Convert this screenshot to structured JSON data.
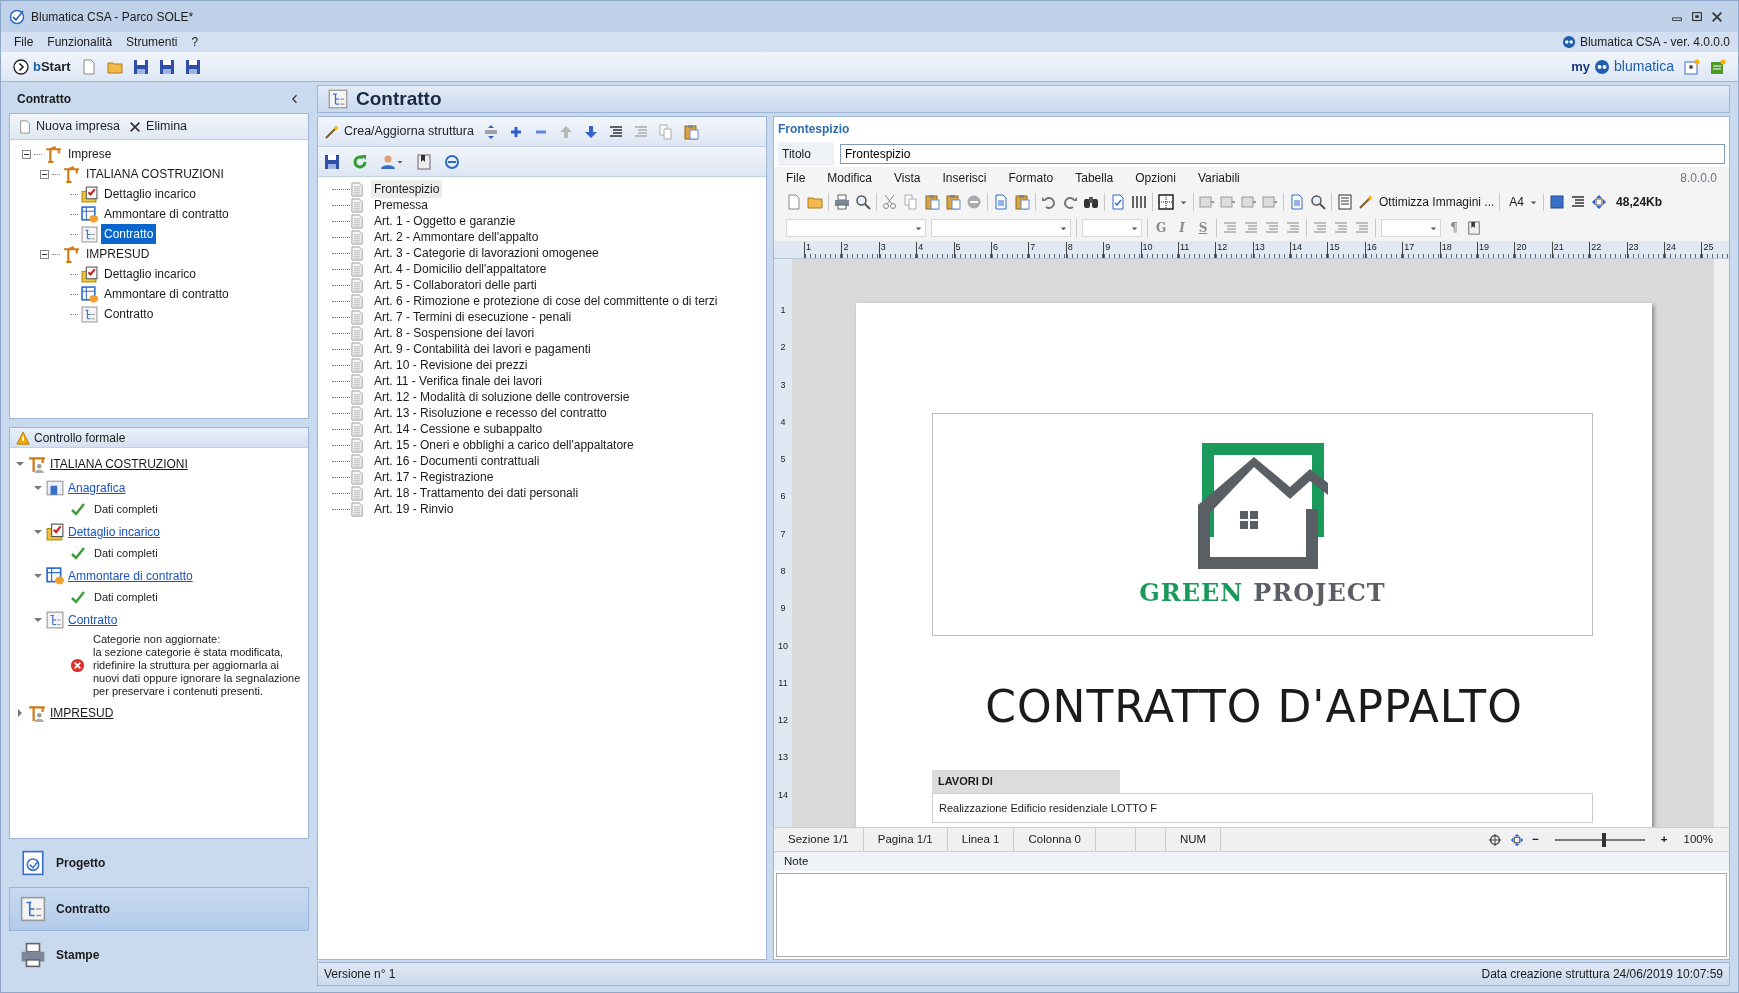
{
  "window": {
    "title": "Blumatica CSA - Parco SOLE*"
  },
  "menu": [
    "File",
    "Funzionalità",
    "Strumenti",
    "?"
  ],
  "version_label": "Blumatica CSA - ver. 4.0.0.0",
  "toolbar": {
    "start": "**b**Start"
  },
  "brand": {
    "prefix": "my",
    "name": "blumatica"
  },
  "left_panel": {
    "title": "Contratto",
    "actions": [
      "Nuova impresa",
      "Elimina"
    ],
    "tree": [
      {
        "label": "Imprese",
        "kind": "crane",
        "expanded": true,
        "selected": false,
        "children": [
          {
            "label": "ITALIANA COSTRUZIONI",
            "kind": "crane",
            "expanded": true,
            "selected": false,
            "children": [
              {
                "label": "Dettaglio incarico",
                "kind": "detail",
                "selected": false
              },
              {
                "label": "Ammontare di contratto",
                "kind": "amount",
                "selected": false
              },
              {
                "label": "Contratto",
                "kind": "contract",
                "selected": true
              }
            ]
          },
          {
            "label": "IMPRESUD",
            "kind": "crane",
            "expanded": true,
            "selected": false,
            "children": [
              {
                "label": "Dettaglio incarico",
                "kind": "detail",
                "selected": false
              },
              {
                "label": "Ammontare di contratto",
                "kind": "amount",
                "selected": false
              },
              {
                "label": "Contratto",
                "kind": "contract",
                "selected": false
              }
            ]
          }
        ]
      }
    ]
  },
  "check_panel": {
    "title": "Controllo formale",
    "tree": [
      {
        "label": "ITALIANA COSTRUZIONI",
        "kind": "company",
        "expanded": true,
        "children": [
          {
            "label": "Anagrafica",
            "kind": "registry",
            "expanded": true,
            "messages": [
              {
                "kind": "ok",
                "text": "Dati completi"
              }
            ]
          },
          {
            "label": "Dettaglio incarico",
            "kind": "detail",
            "expanded": true,
            "messages": [
              {
                "kind": "ok",
                "text": "Dati completi"
              }
            ]
          },
          {
            "label": "Ammontare di contratto",
            "kind": "amount",
            "expanded": true,
            "messages": [
              {
                "kind": "ok",
                "text": "Dati completi"
              }
            ]
          },
          {
            "label": "Contratto",
            "kind": "contract",
            "expanded": true,
            "messages": [
              {
                "kind": "error",
                "text": "Categorie non aggiornate:\nla sezione categorie è stata modificata,\nridefinire la struttura per aggiornarla ai\nnuovi dati oppure ignorare la segnalazione\nper preservare i contenuti presenti."
              }
            ]
          }
        ]
      },
      {
        "label": "IMPRESUD",
        "kind": "company",
        "expanded": false
      }
    ]
  },
  "nav": [
    {
      "label": "Progetto",
      "kind": "project",
      "selected": false
    },
    {
      "label": "Contratto",
      "kind": "contract",
      "selected": true
    },
    {
      "label": "Stampe",
      "kind": "print",
      "selected": false
    }
  ],
  "main": {
    "title": "Contratto",
    "build_button": "Crea/Aggiorna struttura",
    "sections": [
      {
        "label": "Frontespizio",
        "selected": true
      },
      {
        "label": "Premessa",
        "selected": false
      },
      {
        "label": "Art. 1 - Oggetto e garanzie",
        "selected": false
      },
      {
        "label": "Art. 2 - Ammontare dell'appalto",
        "selected": false
      },
      {
        "label": "Art. 3 - Categorie di lavorazioni omogenee",
        "selected": false
      },
      {
        "label": "Art. 4 - Domicilio dell'appaltatore",
        "selected": false
      },
      {
        "label": "Art. 5 - Collaboratori delle parti",
        "selected": false
      },
      {
        "label": "Art. 6 - Rimozione e protezione di cose del committente o di terzi",
        "selected": false
      },
      {
        "label": "Art. 7 - Termini di esecuzione - penali",
        "selected": false
      },
      {
        "label": "Art. 8 - Sospensione dei lavori",
        "selected": false
      },
      {
        "label": "Art. 9 - Contabilità dei lavori e pagamenti",
        "selected": false
      },
      {
        "label": "Art. 10 - Revisione dei prezzi",
        "selected": false
      },
      {
        "label": "Art. 11 - Verifica finale dei lavori",
        "selected": false
      },
      {
        "label": "Art. 12 - Modalità di soluzione delle controversie",
        "selected": false
      },
      {
        "label": "Art. 13 - Risoluzione e recesso del contratto",
        "selected": false
      },
      {
        "label": "Art. 14 - Cessione e subappalto",
        "selected": false
      },
      {
        "label": "Art. 15 - Oneri e obblighi a carico dell'appaltatore",
        "selected": false
      },
      {
        "label": "Art. 16 - Documenti contrattuali",
        "selected": false
      },
      {
        "label": "Art. 17 - Registrazione",
        "selected": false
      },
      {
        "label": "Art. 18 - Trattamento dei dati personali",
        "selected": false
      },
      {
        "label": "Art. 19 - Rinvio",
        "selected": false
      }
    ],
    "version": "Versione n° 1",
    "created": "Data creazione struttura 24/06/2019 10:07:59"
  },
  "editor": {
    "heading": "Frontespizio",
    "title_label": "Titolo",
    "title_value": "Frontespizio",
    "menu": [
      "File",
      "Modifica",
      "Vista",
      "Inserisci",
      "Formato",
      "Tabella",
      "Opzioni",
      "Variabili"
    ],
    "build": "8.0.0.0",
    "optimize": "Ottimizza Immagini ...",
    "page_size": "A4",
    "doc_size": "48,24Kb",
    "format_buttons": [
      "G",
      "I",
      "S"
    ],
    "pilcrow": "¶",
    "ruler": [
      "1",
      "2",
      "3",
      "4",
      "5",
      "6",
      "7",
      "8",
      "9",
      "10",
      "11",
      "12",
      "13",
      "14",
      "15",
      "16",
      "17",
      "18",
      "19",
      "20",
      "21",
      "22",
      "23",
      "24",
      "25"
    ],
    "vruler": [
      "1",
      "2",
      "3",
      "4",
      "5",
      "6",
      "7",
      "8",
      "9",
      "10",
      "11",
      "12",
      "13",
      "14"
    ],
    "document": {
      "logo_words": [
        "GREEN",
        "PROJECT"
      ],
      "title": "CONTRATTO D'APPALTO",
      "works_label": "LAVORI DI",
      "works_text": "Realizzazione Edificio residenziale LOTTO F"
    },
    "status": [
      "Sezione 1/1",
      "Pagina 1/1",
      "Linea 1",
      "Colonna 0",
      "NUM"
    ],
    "zoom": {
      "minus": "−",
      "plus": "+",
      "level": 0.55,
      "reading": "100%"
    },
    "notes_label": "Note"
  }
}
